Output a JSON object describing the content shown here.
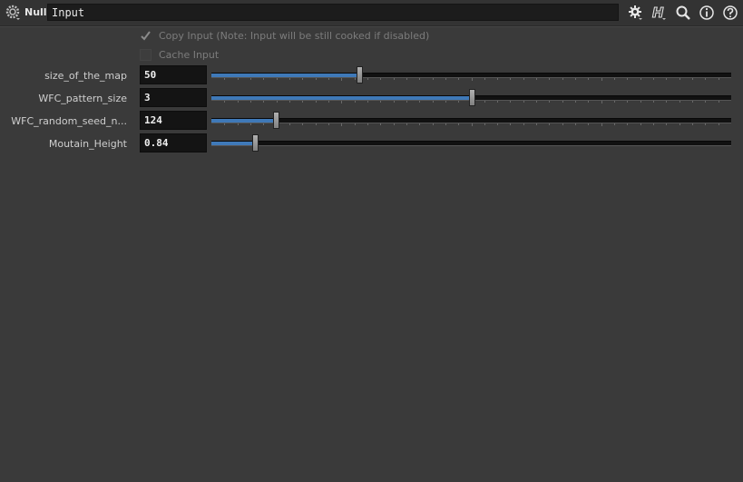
{
  "header": {
    "node_type": "Null",
    "node_name": "Input",
    "icons": [
      "gear-icon",
      "houdini-h-icon",
      "search-icon",
      "info-icon",
      "help-icon"
    ]
  },
  "checkboxes": [
    {
      "label": "Copy Input (Note: Input will be still cooked if disabled)",
      "checked": true
    },
    {
      "label": "Cache Input",
      "checked": false
    }
  ],
  "parms": [
    {
      "label": "size_of_the_map",
      "value": "50",
      "fraction": 0.285
    },
    {
      "label": "WFC_pattern_size",
      "value": "3",
      "fraction": 0.5
    },
    {
      "label": "WFC_random_seed_n...",
      "value": "124",
      "fraction": 0.124
    },
    {
      "label": "Moutain_Height",
      "value": "0.84",
      "fraction": 0.084
    }
  ],
  "colors": {
    "slider_fill": "#3f79b8",
    "background": "#3a3a3a"
  }
}
